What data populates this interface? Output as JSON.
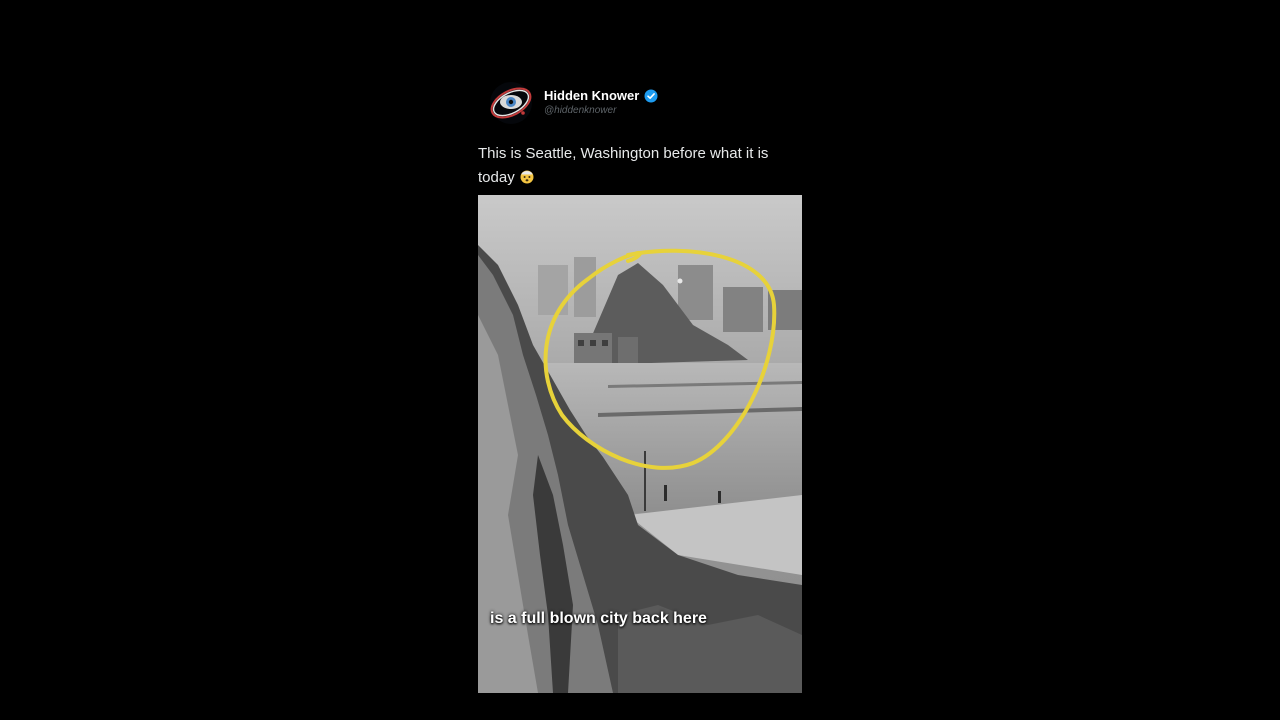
{
  "post": {
    "author": {
      "display_name": "Hidden Knower",
      "handle": "@hiddenknower",
      "verified": true,
      "avatar_icon": "eye-orbit-logo",
      "verified_icon": "verified-badge-icon"
    },
    "text": "This is Seattle, Washington before what it is today",
    "text_emoji": "🤯",
    "media": {
      "type": "video-frame",
      "caption": "is a full blown city back here",
      "annotation_color": "#e7d23a"
    }
  },
  "colors": {
    "background": "#000000",
    "text": "#e7e9ea",
    "handle": "#5e6469",
    "verified": "#1d9bf0"
  }
}
